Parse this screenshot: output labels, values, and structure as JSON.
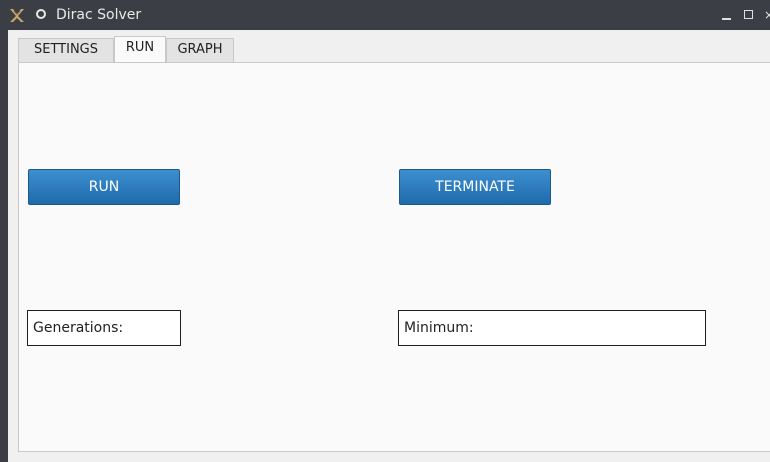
{
  "window": {
    "title": "Dirac Solver",
    "controls": {
      "minimize": "_",
      "close": "×"
    }
  },
  "tabs": [
    {
      "label": "SETTINGS",
      "active": false
    },
    {
      "label": "RUN",
      "active": true
    },
    {
      "label": "GRAPH",
      "active": false
    }
  ],
  "run_panel": {
    "run_button": "RUN",
    "terminate_button": "TERMINATE",
    "generations_label": "Generations:",
    "minimum_label": "Minimum:"
  },
  "icons": {
    "app": "app-logo-icon",
    "pin": "pin-icon",
    "minimize": "minimize-icon",
    "maximize": "maximize-icon",
    "close": "close-icon"
  },
  "colors": {
    "titlebar": "#3b3f45",
    "button_top": "#3d8fd0",
    "button_bottom": "#1f6aab",
    "panel_bg": "#fafafa"
  }
}
